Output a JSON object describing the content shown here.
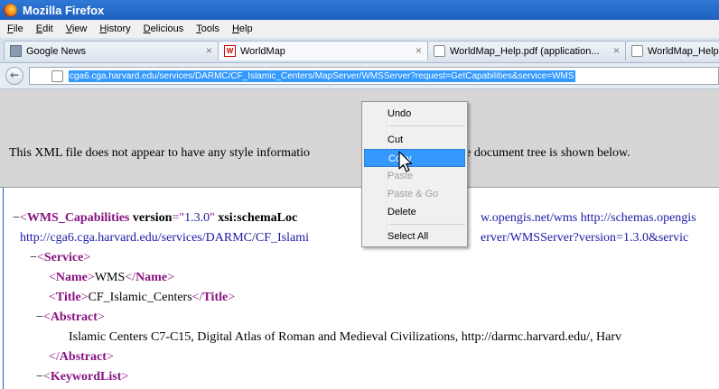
{
  "window": {
    "title": "Mozilla Firefox"
  },
  "menu": [
    "File",
    "Edit",
    "View",
    "History",
    "Delicious",
    "Tools",
    "Help"
  ],
  "tabs": [
    {
      "label": "Google News",
      "icon": "news-favicon-icon"
    },
    {
      "label": "WorldMap",
      "icon": "worldmap-favicon-icon",
      "icon_text": "W"
    },
    {
      "label": "WorldMap_Help.pdf (application...",
      "icon": "page-favicon-icon"
    },
    {
      "label": "WorldMap_Help",
      "icon": "page-favicon-icon"
    }
  ],
  "tab_close_glyph": "×",
  "nav": {
    "back_glyph": "←",
    "url": "cga6.cga.harvard.edu/services/DARMC/CF_Islamic_Centers/MapServer/WMSServer?request=GetCapabilities&service=WMS"
  },
  "infobar": {
    "text_left": "This XML file does not appear to have any style informatio",
    "text_right": "it. The document tree is shown below."
  },
  "xml": {
    "minus": "−",
    "line1": {
      "open": "<",
      "tag": "WMS_Capabilities",
      "attr1": "version",
      "eq1": "=\"",
      "val1": "1.3.0",
      "q1": "\"",
      "attr2": "xsi:schemaLoc",
      "tail": "w.opengis.net/wms http://schemas.opengis"
    },
    "line2": {
      "left": "http://cga6.cga.harvard.edu/services/DARMC/CF_Islami",
      "right": "erver/WMSServer?version=1.3.0&servic"
    },
    "service_tag": "Service",
    "name_tag": "Name",
    "name_value": "WMS",
    "title_tag": "Title",
    "title_value": "CF_Islamic_Centers",
    "abstract_tag": "Abstract",
    "abstract_value": "Islamic Centers C7-C15, Digital Atlas of Roman and Medieval Civilizations, http://darmc.harvard.edu/, Harv",
    "keywordlist_tag": "KeywordList"
  },
  "context_menu": {
    "items": [
      {
        "label": "Undo",
        "enabled": true
      },
      {
        "label": "Cut",
        "enabled": true
      },
      {
        "label": "Copy",
        "enabled": true,
        "highlighted": true
      },
      {
        "label": "Paste",
        "enabled": false
      },
      {
        "label": "Paste & Go",
        "enabled": false
      },
      {
        "label": "Delete",
        "enabled": true
      },
      {
        "label": "Select All",
        "enabled": true
      }
    ]
  },
  "colors": {
    "titlebar": "#1f5fbf",
    "selection": "#3399ff",
    "xml_tag": "#881280",
    "xml_attr_value": "#1a1aa6"
  }
}
